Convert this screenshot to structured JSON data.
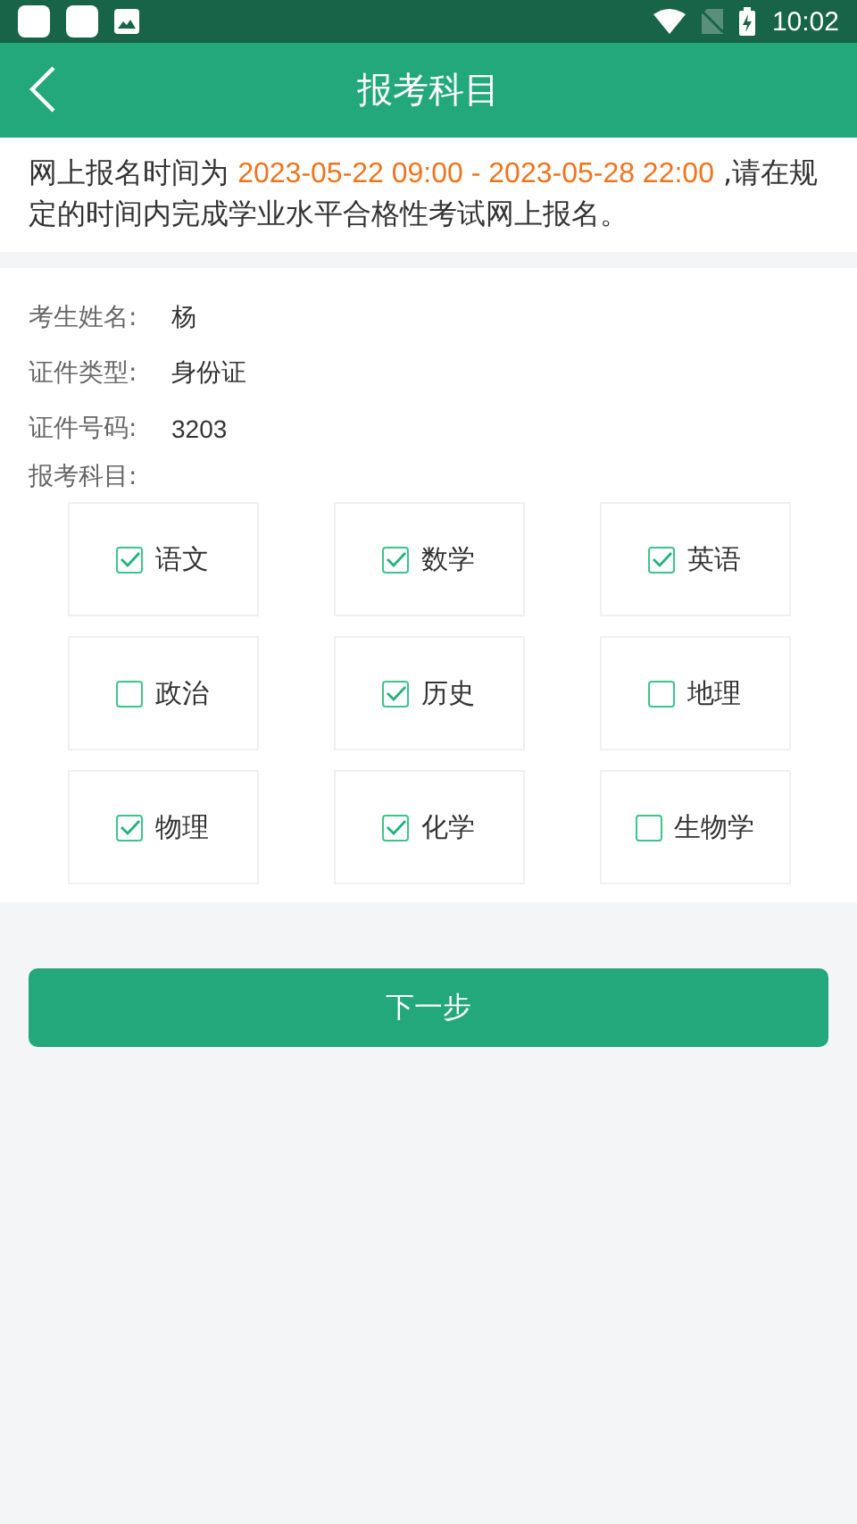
{
  "status_bar": {
    "time": "10:02"
  },
  "header": {
    "title": "报考科目"
  },
  "notice": {
    "before": "网上报名时间为 ",
    "highlight": "2023-05-22 09:00 - 2023-05-28 22:00",
    "after": " ,请在规定的时间内完成学业水平合格性考试网上报名。"
  },
  "fields": [
    {
      "label": "考生姓名:",
      "value": "杨"
    },
    {
      "label": "证件类型:",
      "value": "身份证"
    },
    {
      "label": "证件号码:",
      "value": "3203"
    }
  ],
  "subjects_label": "报考科目:",
  "subjects": [
    {
      "label": "语文",
      "checked": true
    },
    {
      "label": "数学",
      "checked": true
    },
    {
      "label": "英语",
      "checked": true
    },
    {
      "label": "政治",
      "checked": false
    },
    {
      "label": "历史",
      "checked": true
    },
    {
      "label": "地理",
      "checked": false
    },
    {
      "label": "物理",
      "checked": true
    },
    {
      "label": "化学",
      "checked": true
    },
    {
      "label": "生物学",
      "checked": false
    }
  ],
  "next_button": "下一步"
}
